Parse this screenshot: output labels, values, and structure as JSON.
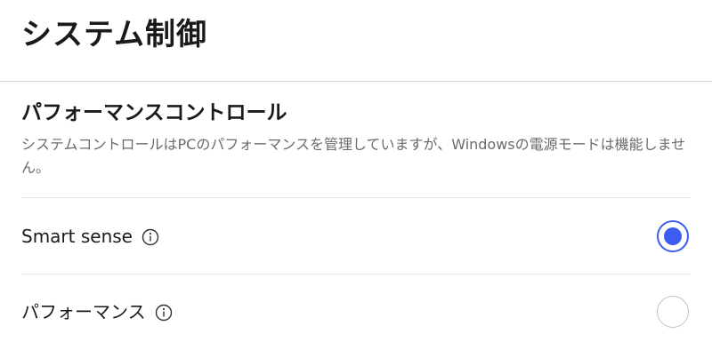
{
  "page": {
    "title": "システム制御"
  },
  "performance_control": {
    "title": "パフォーマンスコントロール",
    "description": "システムコントロールはPCのパフォーマンスを管理していますが、Windowsの電源モードは機能しません。"
  },
  "options": [
    {
      "label": "Smart sense",
      "selected": true,
      "icon": "info-icon"
    },
    {
      "label": "パフォーマンス",
      "selected": false,
      "icon": "info-icon"
    }
  ],
  "colors": {
    "accent": "#3d5cf0",
    "text": "#1a1a1a",
    "secondary_text": "#6b6b6b",
    "divider": "#e6e6e6"
  }
}
